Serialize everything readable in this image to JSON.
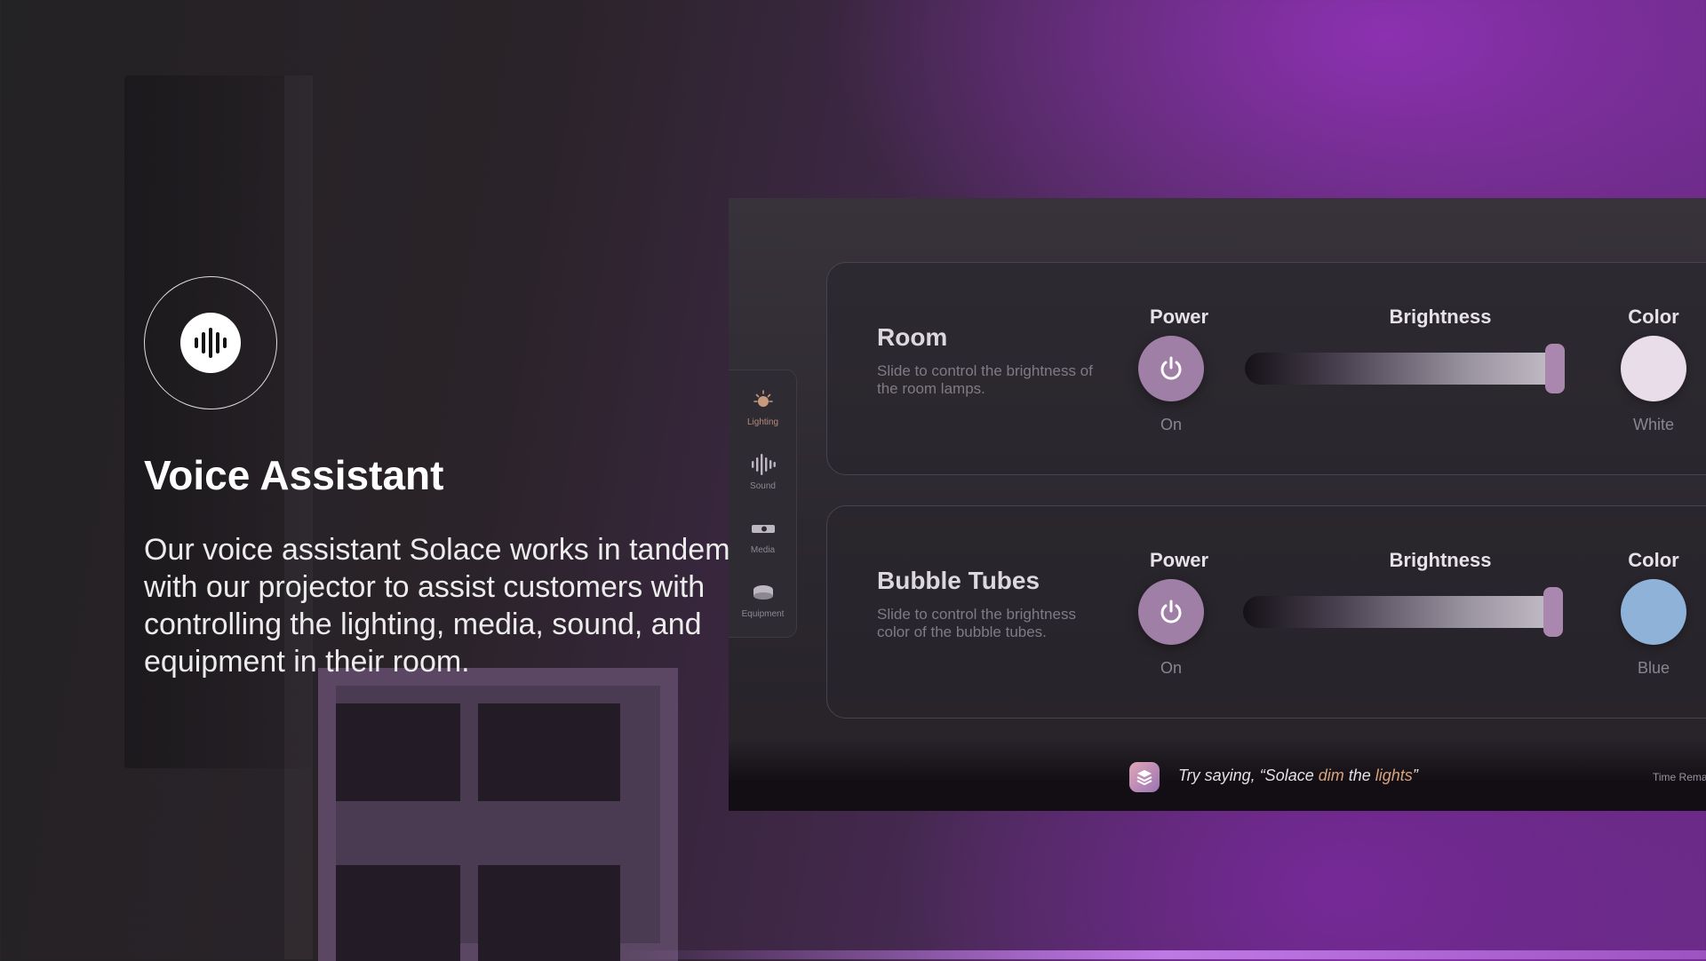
{
  "hero": {
    "title": "Voice Assistant",
    "description": "Our voice assistant Solace works in tandem with our projector to assist customers with controlling the lighting, media, sound, and equipment in their room."
  },
  "nav": {
    "items": [
      {
        "label": "Lighting",
        "icon": "lightbulb-icon",
        "active": true
      },
      {
        "label": "Sound",
        "icon": "sound-wave-icon",
        "active": false
      },
      {
        "label": "Media",
        "icon": "projector-icon",
        "active": false
      },
      {
        "label": "Equipment",
        "icon": "equipment-icon",
        "active": false
      }
    ]
  },
  "controls": {
    "power_heading": "Power",
    "brightness_heading": "Brightness",
    "color_heading": "Color"
  },
  "cards": [
    {
      "title": "Room",
      "description": "Slide to control the brightness of the room lamps.",
      "power_state": "On",
      "brightness_level": 1.0,
      "color_name": "White",
      "color_hex": "#e8dde9"
    },
    {
      "title": "Bubble Tubes",
      "description": "Slide to control the brightness color of the bubble tubes.",
      "power_state": "On",
      "brightness_level": 1.0,
      "color_name": "Blue",
      "color_hex": "#8fb2d8"
    }
  ],
  "hint": {
    "prefix": "Try saying, “Solace ",
    "word1": "dim",
    "middle": " the ",
    "word2": "lights",
    "suffix": "”"
  },
  "time_remaining_label": "Time Rema",
  "colors": {
    "accent": "#a07fa7",
    "highlight": "#d8a47e"
  }
}
